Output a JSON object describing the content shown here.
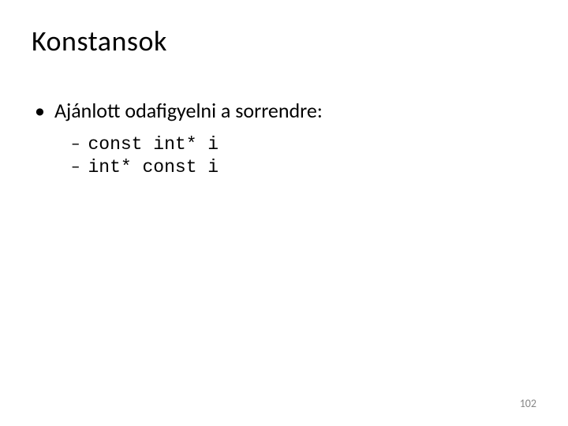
{
  "title": "Konstansok",
  "bullets": {
    "main": "Ajánlott odafigyelni a sorrendre:",
    "sub1": "const int* i",
    "sub2": "int* const i"
  },
  "page_number": "102"
}
